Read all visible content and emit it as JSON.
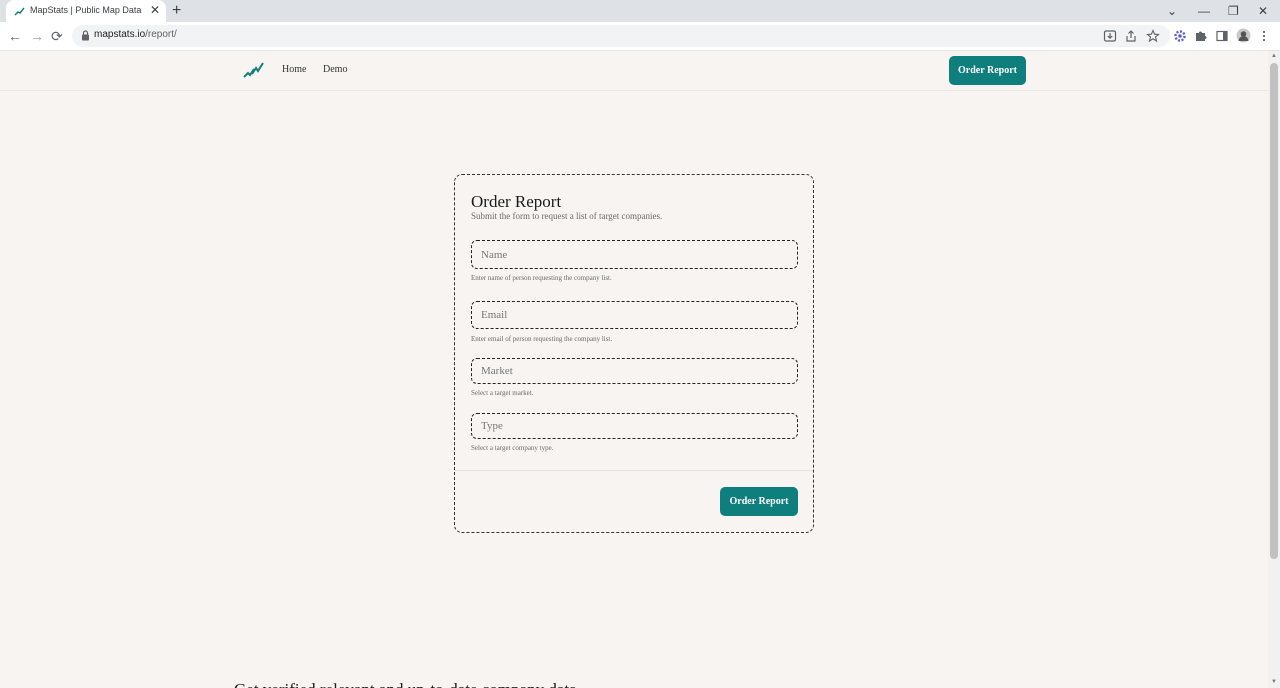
{
  "browser": {
    "tab_title": "MapStats | Public Map Data",
    "tab_close": "✕",
    "new_tab": "+",
    "url_domain": "mapstats.io",
    "url_path": "/report/",
    "window_controls": [
      "⌄",
      "—",
      "❐",
      "✕"
    ],
    "nav": {
      "back": "←",
      "forward": "→",
      "reload": "⟳"
    }
  },
  "site": {
    "brand_color": "#0f7f7d",
    "nav_links": [
      "Home",
      "Demo"
    ],
    "header_cta": "Order Report"
  },
  "form": {
    "title": "Order Report",
    "subtitle": "Submit the form to request a list of target companies.",
    "fields": [
      {
        "placeholder": "Name",
        "hint": "Enter name of person requesting the company list."
      },
      {
        "placeholder": "Email",
        "hint": "Enter email of person requesting the company list."
      },
      {
        "placeholder": "Market",
        "hint": "Select a target market."
      },
      {
        "placeholder": "Type",
        "hint": "Select a target company type."
      }
    ],
    "submit_label": "Order Report"
  },
  "below_fold": {
    "partial_heading": "Get verified relevant and up-to-date company data"
  }
}
